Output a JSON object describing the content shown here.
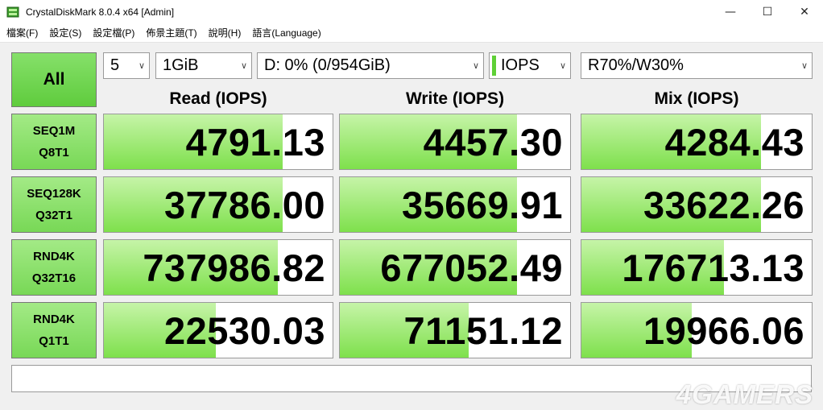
{
  "window": {
    "title": "CrystalDiskMark 8.0.4 x64 [Admin]",
    "minimize": "—",
    "maximize": "☐",
    "close": "✕"
  },
  "menu": [
    "檔案(F)",
    "設定(S)",
    "設定檔(P)",
    "佈景主題(T)",
    "說明(H)",
    "語言(Language)"
  ],
  "controls": {
    "all_label": "All",
    "count": "5",
    "size": "1GiB",
    "drive": "D: 0% (0/954GiB)",
    "unit": "IOPS",
    "mix": "R70%/W30%"
  },
  "columns": [
    "Read (IOPS)",
    "Write (IOPS)",
    "Mix (IOPS)"
  ],
  "rows": [
    {
      "label1": "SEQ1M",
      "label2": "Q8T1",
      "read": "4791.13",
      "write": "4457.30",
      "mix": "4284.43",
      "read_fill": 0.78,
      "write_fill": 0.77,
      "mix_fill": 0.78
    },
    {
      "label1": "SEQ128K",
      "label2": "Q32T1",
      "read": "37786.00",
      "write": "35669.91",
      "mix": "33622.26",
      "read_fill": 0.78,
      "write_fill": 0.77,
      "mix_fill": 0.78
    },
    {
      "label1": "RND4K",
      "label2": "Q32T16",
      "read": "737986.82",
      "write": "677052.49",
      "mix": "176713.13",
      "read_fill": 0.76,
      "write_fill": 0.77,
      "mix_fill": 0.62
    },
    {
      "label1": "RND4K",
      "label2": "Q1T1",
      "read": "22530.03",
      "write": "71151.12",
      "mix": "19966.06",
      "read_fill": 0.49,
      "write_fill": 0.56,
      "mix_fill": 0.48
    }
  ],
  "status": "",
  "watermark": "4GAMERS",
  "colors": {
    "green_fill": "#7ee04c",
    "green_button": "#5fcc3d"
  }
}
